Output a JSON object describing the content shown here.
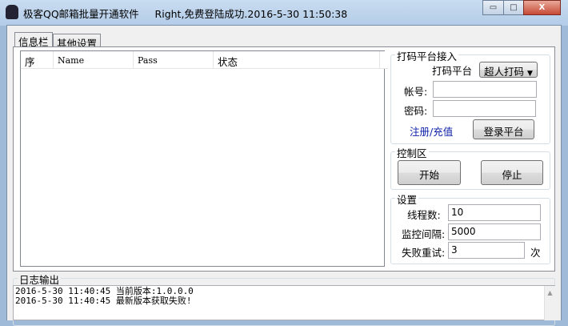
{
  "window": {
    "title": "极客QQ邮箱批量开通软件     Right,免费登陆成功.2016-5-30 11:50:38",
    "minimize": "▭",
    "maximize": "□",
    "close": "X"
  },
  "tabs": [
    "信息栏",
    "其他设置"
  ],
  "list": {
    "columns": [
      "序",
      "Name",
      "Pass",
      "状态"
    ],
    "rows": []
  },
  "captcha": {
    "group": "打码平台接入",
    "platform_label": "打码平台",
    "platform_value": "超人打码",
    "account_label": "帐号:",
    "account_value": "",
    "password_label": "密码:",
    "password_value": "",
    "register_link": "注册/充值",
    "login_button": "登录平台"
  },
  "control": {
    "group": "控制区",
    "start": "开始",
    "stop": "停止"
  },
  "settings": {
    "group": "设置",
    "threads_label": "线程数:",
    "threads": "10",
    "interval_label": "监控间隔:",
    "interval": "5000",
    "retry_label": "失败重试:",
    "retry": "3",
    "retry_unit": "次"
  },
  "log": {
    "group": "日志输出",
    "lines": [
      "2016-5-30 11:40:45 当前版本:1.0.0.0",
      "2016-5-30 11:40:45 最新版本获取失败!"
    ]
  }
}
